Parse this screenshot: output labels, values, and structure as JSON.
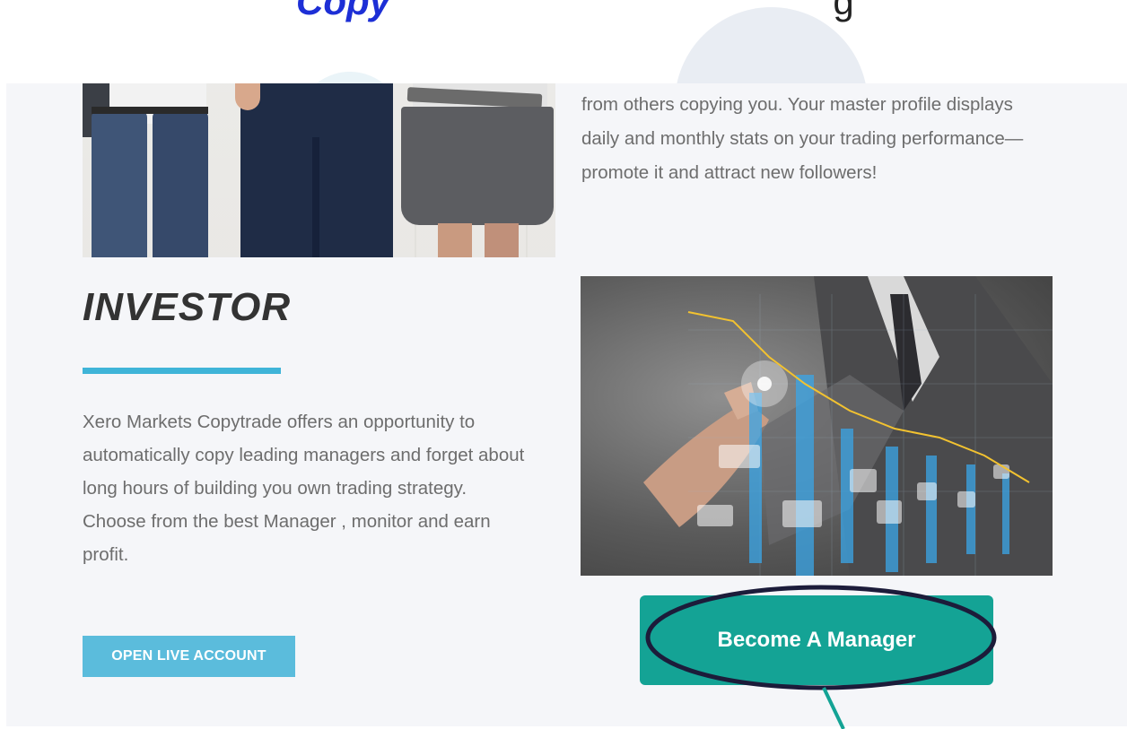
{
  "top_heading": {
    "brand": "Copy",
    "rest": "g"
  },
  "investor": {
    "title": "INVESTOR",
    "description": "Xero Markets Copytrade offers an opportunity to automatically copy leading managers and forget about long hours of building you own trading strategy. Choose from the best Manager , monitor and earn profit.",
    "button_label": "OPEN LIVE ACCOUNT"
  },
  "master": {
    "description": "from others copying you. Your master profile displays daily and monthly stats on your trading performance—promote it and attract new followers!",
    "button_label": "Become A Manager"
  },
  "colors": {
    "accent_blue": "#3fb4d8",
    "open_button": "#5bbcdc",
    "manager_button": "#14a395",
    "annotation": "#1c1c3a"
  },
  "icons": [
    "people-photo",
    "trading-chart-photo",
    "annotation-circle",
    "annotation-arrow"
  ]
}
